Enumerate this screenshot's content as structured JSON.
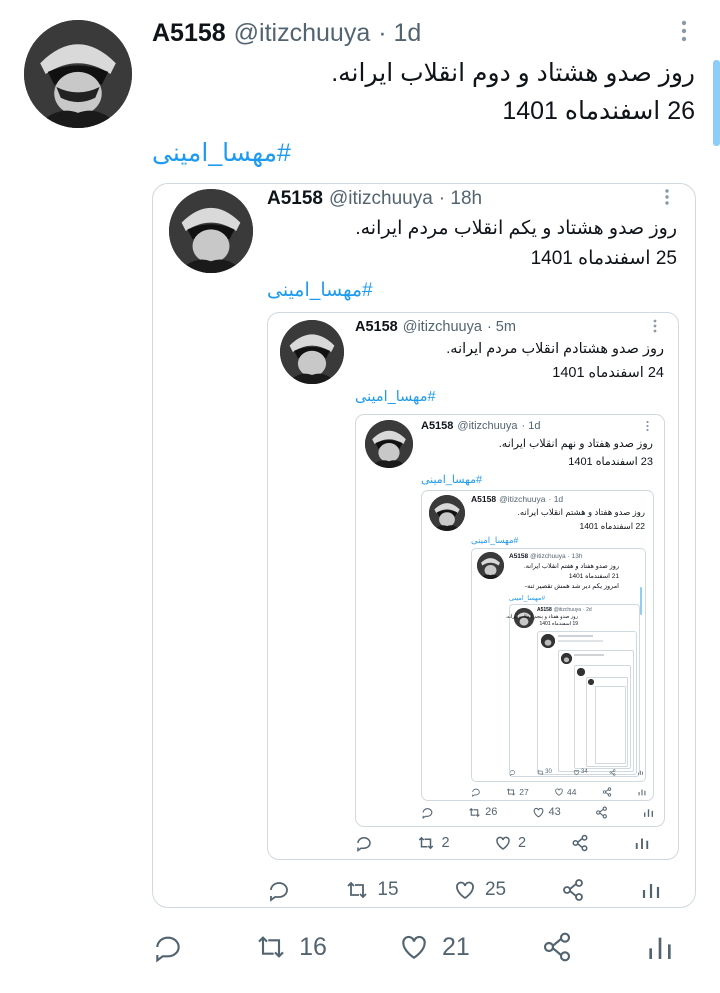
{
  "main": {
    "name": "A5158",
    "handle": "@itizchuuya",
    "time": "· 1d",
    "line1": "روز صدو هشتاد و دوم انقلاب ایرانه.",
    "line2": "26 اسفندماه 1401",
    "hashtag": "#مهسا_امینی",
    "replies": "",
    "retweets": "16",
    "likes": "21"
  },
  "q1": {
    "name": "A5158",
    "handle": "@itizchuuya",
    "time": "· 18h",
    "line1": "روز صدو هشتاد و یکم انقلاب مردم ایرانه.",
    "line2": "25 اسفندماه 1401",
    "hashtag": "#مهسا_امینی",
    "retweets": "15",
    "likes": "25"
  },
  "q2": {
    "name": "A5158",
    "handle": "@itizchuuya",
    "time": "· 5m",
    "line1": "روز صدو هشتادم انقلاب مردم ایرانه.",
    "line2": "24 اسفندماه 1401",
    "hashtag": "#مهسا_امینی",
    "retweets": "2",
    "likes": "2"
  },
  "q3": {
    "name": "A5158",
    "handle": "@itizchuuya",
    "time": "· 1d",
    "line1": "روز صدو هفتاد و نهم انقلاب ایرانه.",
    "line2": "23 اسفندماه 1401",
    "hashtag": "#مهسا_امینی",
    "retweets": "26",
    "likes": "43"
  },
  "q4": {
    "name": "A5158",
    "handle": "@itizchuuya",
    "time": "· 1d",
    "line1": "روز صدو هفتاد و هشتم انقلاب ایرانه.",
    "line2": "22 اسفندماه 1401",
    "hashtag": "#مهسا_امینی",
    "retweets": "27",
    "likes": "44"
  },
  "q5": {
    "name": "A5158",
    "handle": "@itizchuuya",
    "time": "· 13h",
    "line1": "روز صدو هفتاد و هفتم انقلاب ایرانه.",
    "line2": "21 اسفندماه 1401",
    "line3": "امروز یکم دیر شد همش تقصیر ثنه-",
    "hashtag": "#مهسا_امینی",
    "retweets": "30",
    "likes": "34"
  },
  "q6": {
    "name": "A5158",
    "handle": "@itizchuuya",
    "time": "· 2d",
    "line1": "روز صدو هفتاد و پنجم انقلاب ایرانه.",
    "line2": "19 اسفندماه 1401"
  },
  "icons": {
    "reply": "reply-icon",
    "retweet": "retweet-icon",
    "like": "heart-icon",
    "share": "share-icon",
    "analytics": "analytics-icon",
    "more": "more-icon"
  },
  "colors": {
    "link": "#1d9bf0",
    "secondary": "#536471",
    "border": "#cfd9de"
  }
}
